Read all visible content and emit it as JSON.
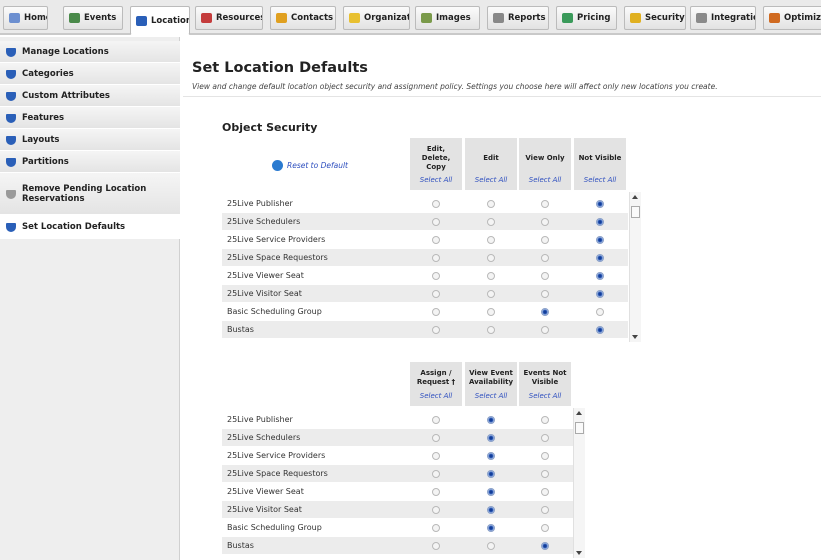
{
  "tabs": [
    {
      "label": "Home",
      "icon": "home-icon",
      "color": "#6c8fd0"
    },
    {
      "label": "Events",
      "icon": "events-icon",
      "color": "#4a8a4a"
    },
    {
      "label": "Locations",
      "icon": "locations-icon",
      "color": "#2a5fb8",
      "active": true
    },
    {
      "label": "Resources",
      "icon": "resources-icon",
      "color": "#c43c3c"
    },
    {
      "label": "Contacts",
      "icon": "contacts-icon",
      "color": "#e0a020"
    },
    {
      "label": "Organizati",
      "icon": "organizations-icon",
      "color": "#e8c030"
    },
    {
      "label": "Images",
      "icon": "images-icon",
      "color": "#7a9a4a"
    },
    {
      "label": "Reports",
      "icon": "reports-icon",
      "color": "#888888"
    },
    {
      "label": "Pricing",
      "icon": "pricing-icon",
      "color": "#3a9a5a"
    },
    {
      "label": "Security",
      "icon": "security-icon",
      "color": "#e0b020"
    },
    {
      "label": "Integratio",
      "icon": "integration-icon",
      "color": "#8a8a8a"
    },
    {
      "label": "Optimizer",
      "icon": "optimizer-icon",
      "color": "#d06a20"
    }
  ],
  "sidebar": {
    "items": [
      {
        "label": "Manage Locations"
      },
      {
        "label": "Categories"
      },
      {
        "label": "Custom Attributes"
      },
      {
        "label": "Features"
      },
      {
        "label": "Layouts"
      },
      {
        "label": "Partitions"
      },
      {
        "label": "Remove Pending Location Reservations",
        "line1": "Remove Pending Location",
        "line2": "Reservations",
        "disabled": true
      },
      {
        "label": "Set Location Defaults",
        "active": true
      }
    ]
  },
  "page": {
    "title": "Set Location Defaults",
    "subtitle": "View and change default location object security and assignment policy. Settings you choose here will affect only new locations you create."
  },
  "object_security": {
    "heading": "Object Security",
    "reset_label": "Reset to Default",
    "columns": [
      {
        "line1": "Edit,",
        "line2": "Delete,",
        "line3": "Copy"
      },
      {
        "line1": "Edit"
      },
      {
        "line1": "View Only"
      },
      {
        "line1": "Not Visible"
      }
    ],
    "select_all": "Select All",
    "rows": [
      {
        "name": "25Live Publisher",
        "selected": 3
      },
      {
        "name": "25Live Schedulers",
        "selected": 3
      },
      {
        "name": "25Live Service Providers",
        "selected": 3
      },
      {
        "name": "25Live Space Requestors",
        "selected": 3
      },
      {
        "name": "25Live Viewer Seat",
        "selected": 3
      },
      {
        "name": "25Live Visitor Seat",
        "selected": 3
      },
      {
        "name": "Basic Scheduling Group",
        "selected": 2
      },
      {
        "name": "Bustas",
        "selected": 3
      }
    ]
  },
  "assignment_policy": {
    "columns": [
      {
        "line1": "Assign /",
        "line2": "Request †"
      },
      {
        "line1": "View Event",
        "line2": "Availability"
      },
      {
        "line1": "Events Not",
        "line2": "Visible"
      }
    ],
    "select_all": "Select All",
    "rows": [
      {
        "name": "25Live Publisher",
        "selected": 1
      },
      {
        "name": "25Live Schedulers",
        "selected": 1
      },
      {
        "name": "25Live Service Providers",
        "selected": 1
      },
      {
        "name": "25Live Space Requestors",
        "selected": 1
      },
      {
        "name": "25Live Viewer Seat",
        "selected": 1
      },
      {
        "name": "25Live Visitor Seat",
        "selected": 1
      },
      {
        "name": "Basic Scheduling Group",
        "selected": 1
      },
      {
        "name": "Bustas",
        "selected": 2
      }
    ]
  }
}
